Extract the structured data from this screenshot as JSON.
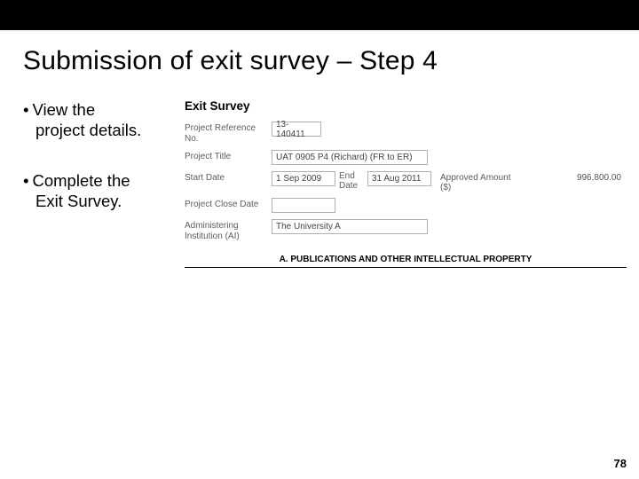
{
  "title": "Submission of exit survey – Step 4",
  "bullets": {
    "b1_first": "View the",
    "b1_rest": "project details.",
    "b2_first": "Complete the",
    "b2_rest": "Exit Survey."
  },
  "form": {
    "heading": "Exit Survey",
    "ref_no_label": "Project Reference No.",
    "ref_no_value": "13-140411",
    "title_label": "Project Title",
    "title_value": "UAT 0905 P4 (Richard) (FR to ER)",
    "start_label": "Start Date",
    "start_value": "1 Sep 2009",
    "end_label": "End Date",
    "end_value": "31 Aug 2011",
    "amount_label": "Approved Amount ($)",
    "amount_value": "996,800.00",
    "close_label": "Project Close Date",
    "admin_label": "Administering Institution (AI)",
    "admin_value": "The University A",
    "section_a": "A. PUBLICATIONS AND OTHER INTELLECTUAL PROPERTY"
  },
  "page_number": "78"
}
